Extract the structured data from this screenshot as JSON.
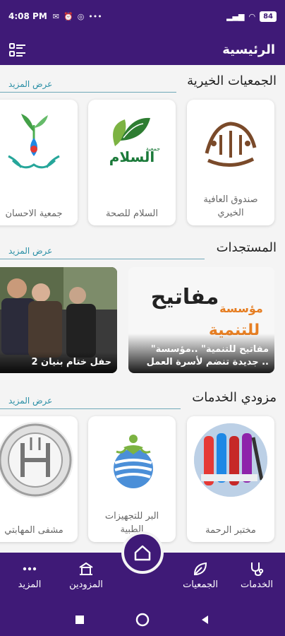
{
  "status_bar": {
    "time": "4:08 PM",
    "battery": "84"
  },
  "header": {
    "title": "الرئيسية"
  },
  "sections": [
    {
      "title": "الجمعيات الخيرية",
      "more": "عرض المزيد",
      "items": [
        {
          "name": "صندوق العافية الخيري"
        },
        {
          "name": "السلام للصحة"
        },
        {
          "name": "جمعية الاحسان"
        }
      ]
    },
    {
      "title": "المستجدات",
      "more": "عرض المزيد",
      "items": [
        {
          "caption": "\"مفاتيح للتنمية\" ..مؤسسة جديدة تنضم لأسرة العمل ..",
          "logo_line1": "مؤسسة",
          "logo_line2": "مفاتيح",
          "logo_line3": "للتنمية"
        },
        {
          "caption": "حفل ختام بنيان 2"
        }
      ]
    },
    {
      "title": "مزودي الخدمات",
      "more": "عرض المزيد",
      "items": [
        {
          "name": "مختبر الرحمة"
        },
        {
          "name": "البر للتجهيزات الطبية"
        },
        {
          "name": "مشفى المهابتي"
        }
      ]
    }
  ],
  "logos": {
    "salam_text": "السلام",
    "salam_small": "جمعية",
    "fund_text": "صندوق العافية"
  },
  "bottom_nav": {
    "services": "الخدمات",
    "societies": "الجمعيات",
    "providers": "المزودين",
    "more": "المزيد"
  },
  "colors": {
    "primary": "#3f1a77",
    "accent": "#2a8fa6"
  }
}
